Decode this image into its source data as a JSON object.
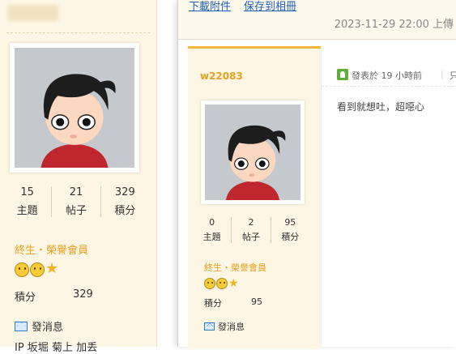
{
  "sidebar": {
    "stats": [
      {
        "value": "15",
        "label": "主題"
      },
      {
        "value": "21",
        "label": "帖子"
      },
      {
        "value": "329",
        "label": "積分"
      }
    ],
    "rank": "終生・榮譽會員",
    "score_label": "積分",
    "score_value": "329",
    "message_label": "發消息",
    "cut_text": "IP 坂堀 菊上 加丢"
  },
  "attachment": {
    "download_label": "下載附件",
    "save_label": "保存到相冊",
    "upload_info": "2023-11-29 22:00 上傳"
  },
  "post": {
    "author": "w22083",
    "stats": [
      {
        "value": "0",
        "label": "主題"
      },
      {
        "value": "2",
        "label": "帖子"
      },
      {
        "value": "95",
        "label": "積分"
      }
    ],
    "rank": "終生・榮譽會員",
    "score_label": "積分",
    "score_value": "95",
    "message_label": "發消息",
    "posted_at": "發表於 19 小時前",
    "separator": "|",
    "only_label": "只",
    "content": "看到就想吐，超噁心"
  },
  "colors": {
    "rank": "#e8a020",
    "link": "#2060b0",
    "sidebar_bg": "#fdf6e4",
    "accent_border": "#f5b73c"
  },
  "icons": [
    "avatar-cartoon-boy",
    "smiley-badge-icon",
    "star-badge-icon",
    "mail-icon",
    "post-status-icon"
  ]
}
